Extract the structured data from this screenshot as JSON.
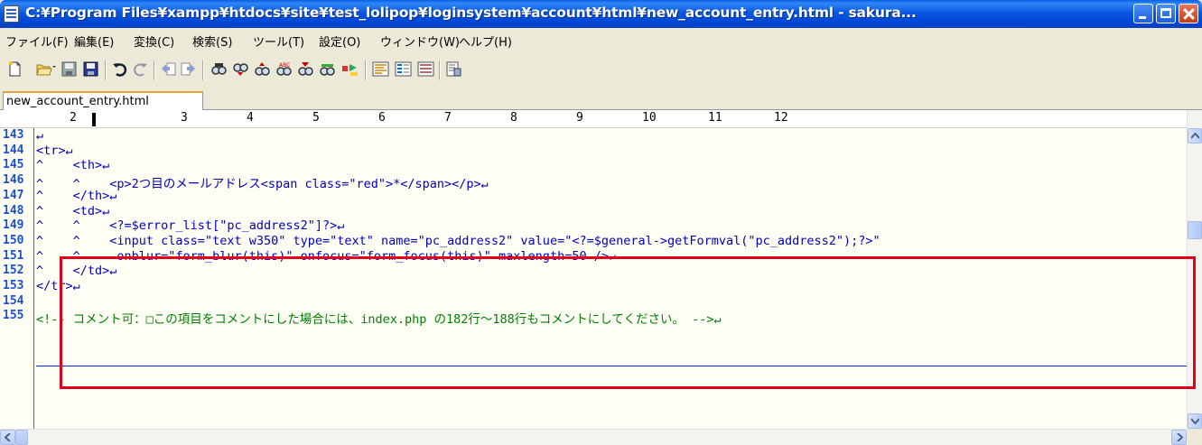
{
  "window": {
    "title": "C:¥Program Files¥xampp¥htdocs¥site¥test_lolipop¥loginsystem¥account¥html¥new_account_entry.html - sakura..."
  },
  "menu": [
    "ファイル(F)",
    "編集(E)",
    "変換(C)",
    "検索(S)",
    "ツール(T)",
    "設定(O)",
    "ウィンドウ(W)",
    "ヘルプ(H)"
  ],
  "toolbar": {
    "icons": [
      "new-document-icon",
      "open-folder-icon",
      "save-icon",
      "save-all-icon",
      "undo-icon",
      "redo-icon",
      "jump-back-icon",
      "jump-forward-icon",
      "find-icon",
      "find-next-icon",
      "find-prev-icon",
      "replace-icon",
      "grep-icon",
      "compare-icon",
      "tag-jump-icon",
      "outline-icon",
      "function-list-icon",
      "macro-icon",
      "settings-icon"
    ]
  },
  "tab": {
    "label": "new_account_entry.html"
  },
  "ruler": {
    "numbers": [
      "2",
      "3",
      "4",
      "5",
      "6",
      "7",
      "8",
      "9",
      "10",
      "11",
      "12"
    ]
  },
  "editor": {
    "lines": [
      {
        "num": "143",
        "text": "↵"
      },
      {
        "num": "144",
        "text": "<tr>↵"
      },
      {
        "num": "145",
        "text": "^    <th>↵"
      },
      {
        "num": "146",
        "text": "^    ^    <p>2つ目のメールアドレス<span class=\"red\">*</span></p>↵"
      },
      {
        "num": "147",
        "text": "^    </th>↵"
      },
      {
        "num": "148",
        "text": "^    <td>↵"
      },
      {
        "num": "149",
        "text": "^    ^    <?=$error_list[\"pc_address2\"]?>↵"
      },
      {
        "num": "150",
        "text": "^    ^    <input class=\"text w350\" type=\"text\" name=\"pc_address2\" value=\"<?=$general->getFormval(\"pc_address2\");?>\""
      },
      {
        "num": "151",
        "text": "^    ^     onblur=\"form_blur(this)\" onfocus=\"form_focus(this)\" maxlength=50 />↵"
      },
      {
        "num": "152",
        "text": "^    </td>↵"
      },
      {
        "num": "153",
        "text": "</tr>↵"
      },
      {
        "num": "154",
        "text": ""
      },
      {
        "num": "155",
        "text": "<!-- コメント可：□この項目をコメントにした場合には、index.php の182行～188行もコメントにしてください。 -->↵"
      }
    ]
  },
  "colors": {
    "titlebar": "#0a58e2",
    "highlight": "#e0001a",
    "line_number": "#1d4fcf",
    "comment": "#008000"
  }
}
